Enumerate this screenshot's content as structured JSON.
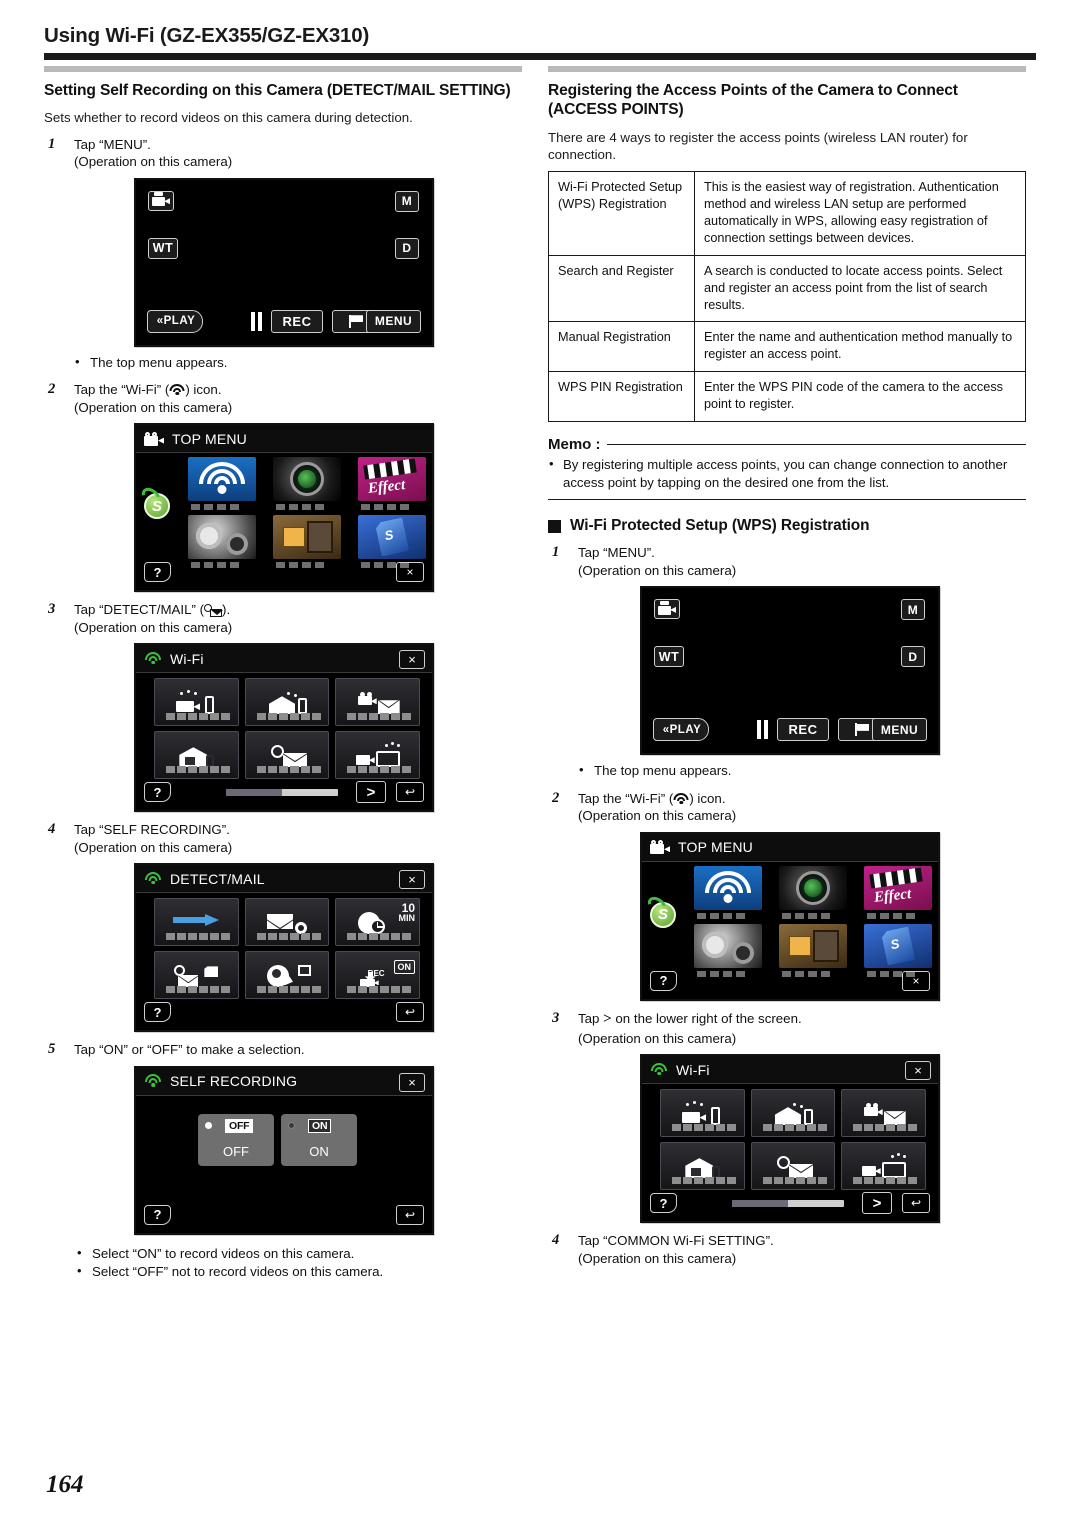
{
  "running_head": {
    "title": "Using Wi-Fi (GZ-EX355/GZ-EX310)"
  },
  "page_number": "164",
  "left_column": {
    "section_title": "Setting Self Recording on this Camera (DETECT/MAIL SETTING)",
    "intro": "Sets whether to record videos on this camera during detection.",
    "steps": [
      {
        "num": "1",
        "line": "Tap “MENU”.",
        "sub": "(Operation on this camera)"
      },
      {
        "num": "2",
        "line_pre": "Tap the “Wi-Fi” (",
        "line_post": ") icon.",
        "sub": "(Operation on this camera)"
      },
      {
        "num": "3",
        "line_pre": "Tap “DETECT/MAIL” (",
        "line_post": ").",
        "sub": "(Operation on this camera)"
      },
      {
        "num": "4",
        "line": "Tap “SELF RECORDING”.",
        "sub": "(Operation on this camera)"
      },
      {
        "num": "5",
        "line": "Tap “ON” or “OFF” to make a selection.",
        "sub": ""
      }
    ],
    "note_top_menu": "The top menu appears.",
    "final_bullets": [
      "Select “ON” to record videos on this camera.",
      "Select “OFF” not to record videos on this camera."
    ]
  },
  "right_column": {
    "section_title": "Registering the Access Points of the Camera to Connect (ACCESS POINTS)",
    "intro": "There are 4 ways to register the access points (wireless LAN router) for connection.",
    "table": {
      "rows": [
        {
          "method": "Wi-Fi Protected Setup (WPS) Registration",
          "description": "This is the easiest way of registration. Authentication method and wireless LAN setup are performed automatically in WPS, allowing easy registration of connection settings between devices."
        },
        {
          "method": "Search and Register",
          "description": "A search is conducted to locate access points. Select and register an access point from the list of search results."
        },
        {
          "method": "Manual Registration",
          "description": "Enter the name and authentication method manually to register an access point."
        },
        {
          "method": "WPS PIN Registration",
          "description": "Enter the WPS PIN code of the camera to the access point to register."
        }
      ]
    },
    "memo": {
      "label": "Memo :",
      "bullets": [
        "By registering multiple access points, you can change connection to another access point by tapping on the desired one from the list."
      ]
    },
    "subsection_title": "Wi-Fi Protected Setup (WPS) Registration",
    "steps": [
      {
        "num": "1",
        "line": "Tap “MENU”.",
        "sub": "(Operation on this camera)"
      },
      {
        "num": "2",
        "line_pre": "Tap the “Wi-Fi” (",
        "line_post": ") icon.",
        "sub": "(Operation on this camera)"
      },
      {
        "num": "3",
        "line_pre": "Tap ",
        "line_mid": ">",
        "line_post": " on the lower right of the screen.",
        "sub": "(Operation on this camera)"
      },
      {
        "num": "4",
        "line": "Tap “COMMON Wi-Fi SETTING”.",
        "sub": "(Operation on this camera)"
      }
    ],
    "note_top_menu": "The top menu appears."
  },
  "screens": {
    "rec": {
      "name": "recording-screen",
      "camera_mode_icon": "video-camera-icon",
      "manual_badge": "M",
      "zoom_badge": "WT",
      "display_badge": "D",
      "play_button": "PLAY",
      "rec_button": "REC",
      "pause_button": "pause-icon",
      "flag_button": "flag-icon",
      "menu_button": "MENU"
    },
    "top_menu": {
      "title": "TOP MENU",
      "header_icon": "video-camera-icon",
      "tiles": [
        "wifi-tile",
        "lens-tile",
        "effect-tile",
        "settings-gear-tile",
        "media-tile",
        "sd-card-tile"
      ],
      "effect_tile_text": "Effect",
      "shortcut_icon": "shortcut-coin-icon",
      "shortcut_letter": "S",
      "help_button": "?",
      "close_button": "×"
    },
    "wifi_menu": {
      "title": "Wi-Fi",
      "header_icon": "wifi-icon",
      "tiles": [
        "direct-monitoring-tile",
        "indoor-monitoring-tile",
        "video-mail-tile",
        "outdoor-monitoring-tile",
        "detect-mail-tile",
        "tv-monitoring-tile"
      ],
      "help_button": "?",
      "close_button": "×",
      "next_button": ">",
      "back_button": "↩"
    },
    "detect_mail": {
      "title": "DETECT/MAIL",
      "header_icon": "wifi-icon",
      "tiles": [
        "detection-method-tile",
        "mail-setting-tile",
        "detection-interval-tile",
        "mail-recipient-tile",
        "self-recording-tile",
        "rec-on-tile"
      ],
      "interval_badge_value": "10",
      "interval_badge_unit": "MIN",
      "rec_badge": "REC",
      "on_badge": "ON",
      "help_button": "?",
      "close_button": "×",
      "back_button": "↩"
    },
    "self_recording": {
      "title": "SELF RECORDING",
      "header_icon": "wifi-icon",
      "options": [
        {
          "tag": "OFF",
          "label": "OFF",
          "selected": true
        },
        {
          "tag": "ON",
          "label": "ON",
          "selected": false
        }
      ],
      "help_button": "?",
      "close_button": "×",
      "back_button": "↩"
    }
  }
}
